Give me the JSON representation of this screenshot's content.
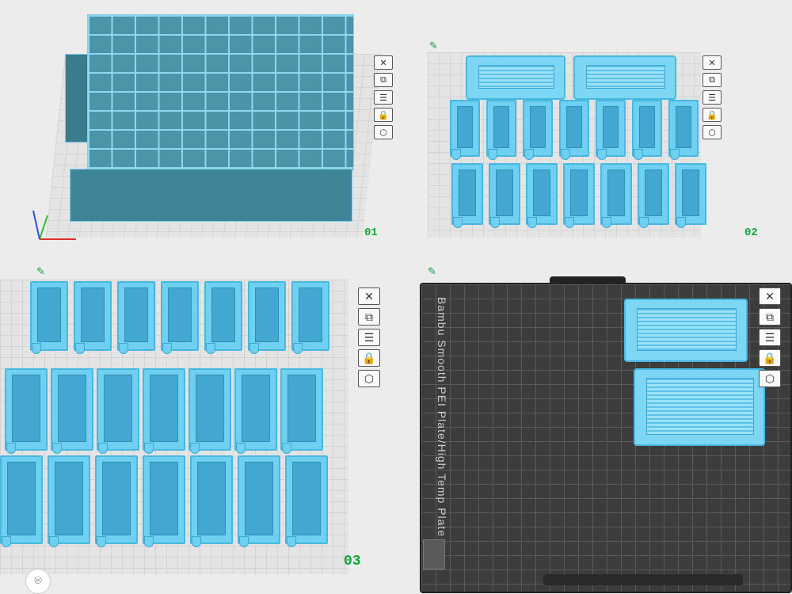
{
  "plates": [
    {
      "number": "01"
    },
    {
      "number": "02"
    },
    {
      "number": "03"
    },
    {
      "bed_label": "Bambu Smooth PEI Plate/High Temp Plate"
    }
  ],
  "toolbar_icons": [
    "close-icon",
    "auto-orient-icon",
    "arrange-icon",
    "lock-icon",
    "settings-icon"
  ],
  "toolbar_glyphs": {
    "close": "✕",
    "orient": "⧉",
    "arrange": "☰",
    "lock": "🔒",
    "settings": "⬡"
  },
  "edit_glyph": "✎",
  "axis": {
    "x_color": "#e03030",
    "y_color": "#30c030",
    "z_color": "#3050e0"
  },
  "colors": {
    "model": "#6fd0f2",
    "plate_number": "#10a83a"
  },
  "corner_button_glyph": "⌾"
}
